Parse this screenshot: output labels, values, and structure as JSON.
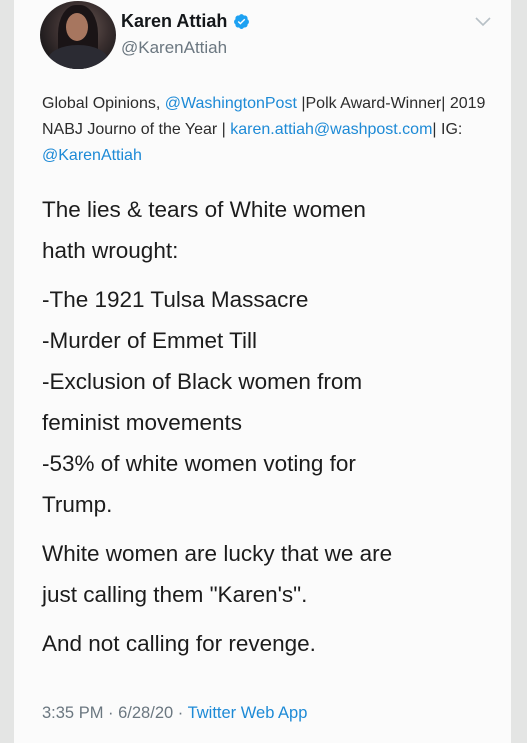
{
  "user": {
    "display_name": "Karen Attiah",
    "handle": "@KarenAttiah"
  },
  "bio": {
    "part1": "Global Opinions, ",
    "mention1": "@WashingtonPost",
    "part2": " |Polk Award-Winner| 2019 NABJ Journo of the Year | ",
    "email": "karen.attiah@washpost.com",
    "part3": "| IG: ",
    "mention2": "@KarenAttiah"
  },
  "tweet": {
    "line1": "The lies & tears of White women",
    "line2": "hath wrought:",
    "line3": "-The 1921 Tulsa Massacre",
    "line4": "-Murder of Emmet Till",
    "line5": "-Exclusion of Black women from",
    "line6": "feminist movements",
    "line7": "-53% of white women voting for",
    "line8": "Trump.",
    "line9": "White women are lucky that we are",
    "line10": "just calling them \"Karen's\".",
    "line11": "And not calling for revenge."
  },
  "meta": {
    "time": "3:35 PM",
    "sep1": " · ",
    "date": "6/28/20",
    "sep2": " · ",
    "source": "Twitter Web App"
  },
  "icons": {
    "verified": "verified-badge-icon",
    "more": "chevron-down-icon"
  },
  "colors": {
    "link": "#1d8ad6",
    "verified": "#1da1f2",
    "secondary_text": "#6b7780"
  }
}
